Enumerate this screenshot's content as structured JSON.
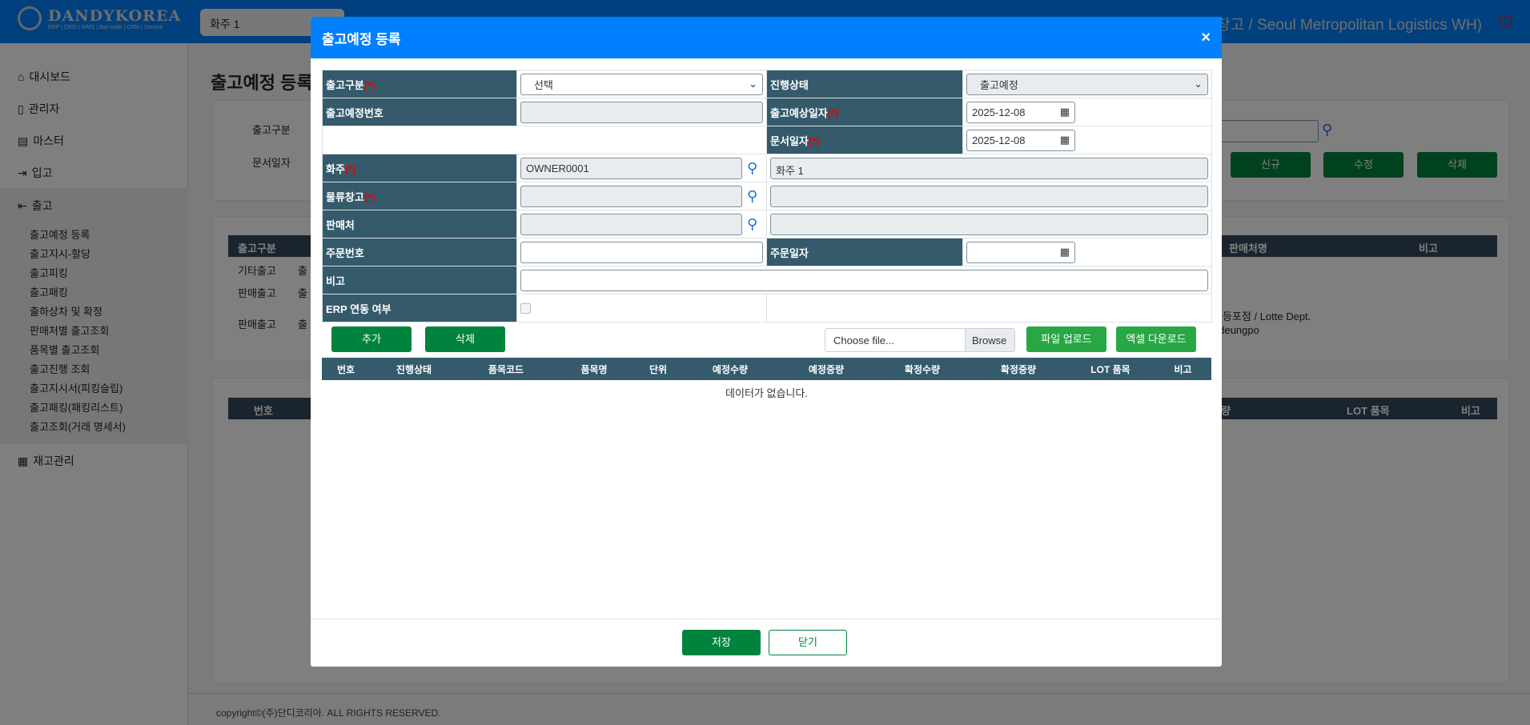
{
  "header": {
    "brand": "DANDYKOREA",
    "brand_sub": "ERP | CRO | WMS | Bar-code | CRM | Service",
    "owner_select": "화주 1",
    "user_info": "물류창고 / Seoul Metropolitan Logistics WH)"
  },
  "sidebar": {
    "items": [
      {
        "label": "대시보드"
      },
      {
        "label": "관리자"
      },
      {
        "label": "마스터"
      },
      {
        "label": "입고"
      },
      {
        "label": "출고"
      }
    ],
    "sub_items": [
      "출고예정 등록",
      "출고지시-할당",
      "출고피킹",
      "출고패킹",
      "출하상차 및 확정",
      "판매처별 출고조회",
      "품목별 출고조회",
      "출고진행 조회",
      "출고지시서(피킹슬립)",
      "출고패킹(패킹리스트)",
      "출고조회(거래 명세서)"
    ],
    "inventory": "재고관리"
  },
  "page": {
    "title": "출고예정 등록",
    "filter_labels": [
      "출고구분",
      "문서일자"
    ],
    "buttons": [
      "신규",
      "수정",
      "삭제"
    ],
    "list_headers": {
      "first": "출고구분",
      "seller": "판매처명",
      "remark": "비고"
    },
    "list_rows": [
      {
        "type": "기타출고",
        "col2": "출"
      },
      {
        "type": "판매출고",
        "col2": "출"
      },
      {
        "type": "판매출고",
        "col2": "출",
        "seller": "영등포점 / Lotte Dept.",
        "seller2": "gdeungpo"
      }
    ],
    "detail_headers": {
      "no": "번호",
      "qty": "량",
      "lot": "LOT 품목",
      "remark": "비고"
    },
    "footer": "copyright©(주)단디코리아. ALL RIGHTS RESERVED."
  },
  "modal": {
    "title": "출고예정 등록",
    "close": "×",
    "labels": {
      "out_type": "출고구분",
      "status": "진행상태",
      "plan_no": "출고예정번호",
      "plan_date": "출고예상일자",
      "doc_date": "문서일자",
      "owner": "화주",
      "warehouse": "물류창고",
      "seller": "판매처",
      "order_no": "주문번호",
      "order_date": "주문일자",
      "remark": "비고",
      "erp": "ERP 연동 여부"
    },
    "req": "(*)",
    "values": {
      "out_type": "선택",
      "status": "출고예정",
      "plan_no": "",
      "plan_date": "2025-12-08",
      "doc_date": "2025-12-08",
      "owner_code": "OWNER0001",
      "owner_name": "화주 1",
      "warehouse_code": "",
      "warehouse_name": "",
      "seller_code": "",
      "seller_name": "",
      "order_no": "",
      "order_date": "",
      "remark": ""
    },
    "buttons": {
      "add": "추가",
      "delete": "삭제",
      "file_placeholder": "Choose file...",
      "browse": "Browse",
      "upload": "파일 업로드",
      "excel": "엑셀 다운로드",
      "save": "저장",
      "close": "닫기"
    },
    "item_headers": [
      "번호",
      "진행상태",
      "품목코드",
      "품목명",
      "단위",
      "예정수량",
      "예정중량",
      "확정수량",
      "확정중량",
      "LOT 품목",
      "비고"
    ],
    "empty": "데이터가 없습니다."
  }
}
